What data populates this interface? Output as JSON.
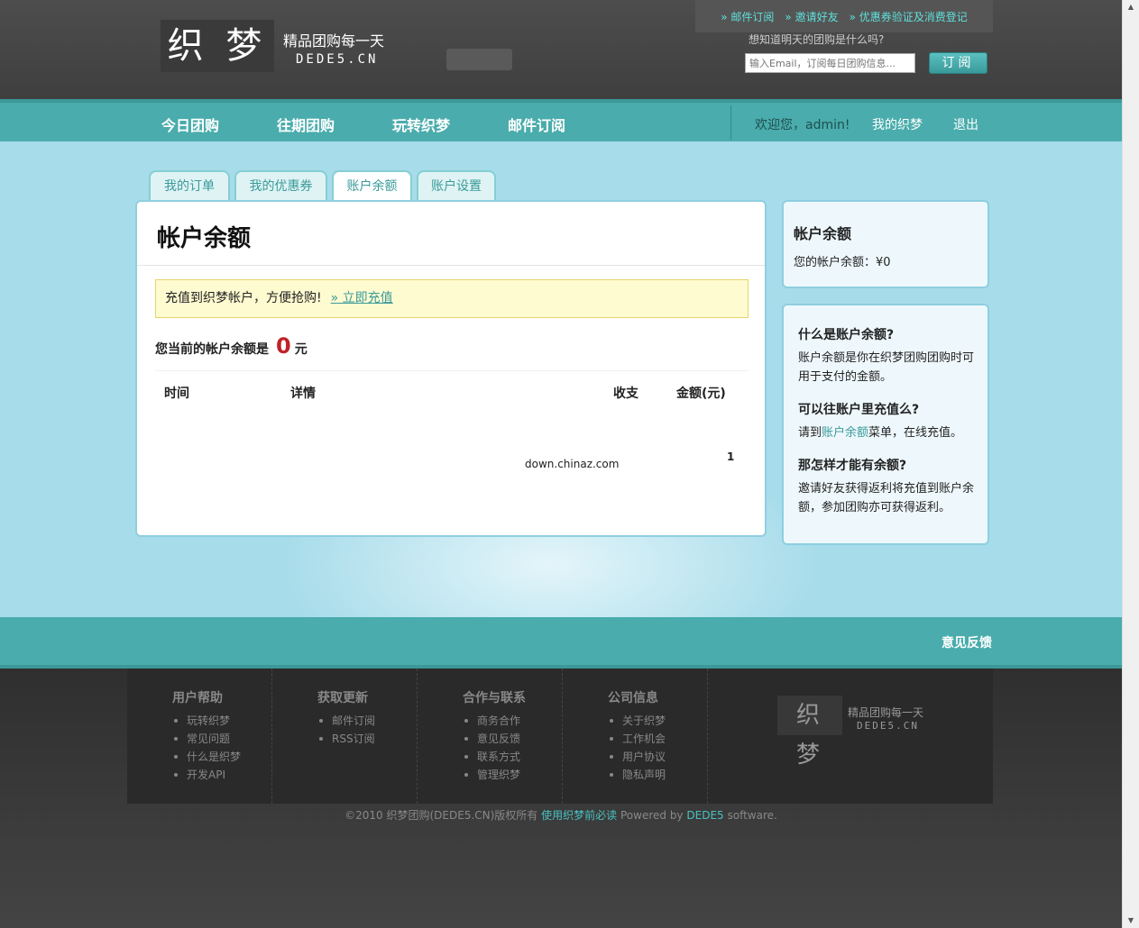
{
  "header": {
    "logo_text": "织 梦",
    "slogan": "精品团购每一天",
    "domain": "DEDE5.CN",
    "top_links": [
      "» 邮件订阅",
      "» 邀请好友",
      "» 优惠券验证及消费登记"
    ],
    "subscribe_question": "想知道明天的团购是什么吗?",
    "subscribe_placeholder": "输入Email，订阅每日团购信息...",
    "subscribe_button": "订阅"
  },
  "nav": {
    "items": [
      "今日团购",
      "往期团购",
      "玩转织梦",
      "邮件订阅"
    ],
    "welcome": "欢迎您，admin!",
    "my_account": "我的织梦",
    "logout": "退出"
  },
  "tabs": [
    "我的订单",
    "我的优惠券",
    "账户余额",
    "账户设置"
  ],
  "active_tab": 2,
  "main": {
    "title": "帐户余额",
    "notice_text": "充值到织梦帐户，方便抢购!",
    "notice_link": "» 立即充值",
    "balance_label": "您当前的帐户余额是",
    "balance_value": "0",
    "balance_unit": "元",
    "table_headers": [
      "时间",
      "详情",
      "收支",
      "金额(元)"
    ],
    "table_cell_detail": "down.chinaz.com",
    "table_cell_page": "1"
  },
  "sidebar": {
    "balance_title": "帐户余额",
    "balance_text": "您的帐户余额：¥0",
    "faq": [
      {
        "q": "什么是账户余额?",
        "a_before": "账户余额是你在织梦团购团购时可用于支付的金额。",
        "link": "",
        "a_after": ""
      },
      {
        "q": "可以往账户里充值么?",
        "a_before": "请到",
        "link": "账户余额",
        "a_after": "菜单，在线充值。"
      },
      {
        "q": "那怎样才能有余额?",
        "a_before": "邀请好友获得返利将充值到账户余额，参加团购亦可获得返利。",
        "link": "",
        "a_after": ""
      }
    ]
  },
  "feedback": "意见反馈",
  "footer": {
    "columns": [
      {
        "title": "用户帮助",
        "items": [
          "玩转织梦",
          "常见问题",
          "什么是织梦",
          "开发API"
        ]
      },
      {
        "title": "获取更新",
        "items": [
          "邮件订阅",
          "RSS订阅"
        ]
      },
      {
        "title": "合作与联系",
        "items": [
          "商务合作",
          "意见反馈",
          "联系方式",
          "管理织梦"
        ]
      },
      {
        "title": "公司信息",
        "items": [
          "关于织梦",
          "工作机会",
          "用户协议",
          "隐私声明"
        ]
      }
    ],
    "logo_text": "织 梦",
    "slogan": "精品团购每一天",
    "domain": "DEDE5.CN",
    "copyright": "©2010 织梦团购(DEDE5.CN)版权所有",
    "must_read": "使用织梦前必读",
    "powered_by": "Powered by",
    "powered_link": "DEDE5",
    "software": "software."
  }
}
